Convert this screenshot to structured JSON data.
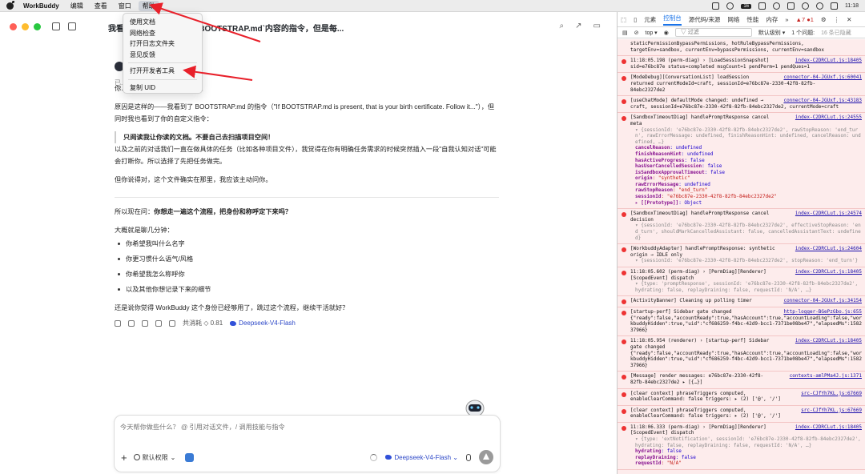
{
  "menubar": {
    "app_name": "WorkBuddy",
    "menus": [
      "编辑",
      "查看",
      "窗口",
      "帮助"
    ],
    "badge": "16",
    "time": "11:18"
  },
  "help_menu": {
    "items": [
      "使用文档",
      "网络检查",
      "打开日志文件夹",
      "意见反馈",
      "打开开发者工具",
      "复制 UID"
    ]
  },
  "chat": {
    "title": "我看到你收到了关于遵循`BOOTSTRAP.md`内容的指令，但是每...",
    "bot_label": "已...",
    "p_partial": "你... BOOTSTRAP.md 的流程。",
    "p1": "原因是这样的——我看到了 BOOTSTRAP.md 的指令（\"If BOOTSTRAP.md is present, that is your birth certificate. Follow it...\"），但同时我也看到了你的自定义指令：",
    "quote": "只阅读我让你读的文档。不要自己去扫描项目空间！",
    "p2": "以及之前的对话我们一直在做具体的任务（比如各种项目文件），我觉得在你有明确任务需求的时候突然插入一段\"自我认知对话\"可能会打断你。所以选择了先把任务做完。",
    "p3": "但你说得对，这个文件确实在那里，我应该主动问你。",
    "ask_prefix": "所以现在问：",
    "ask_bold": "你想走一遍这个流程，把身份和称呼定下来吗？",
    "list_intro": "大概就是聊几分钟：",
    "list": [
      "你希望我叫什么名字",
      "你更习惯什么语气/风格",
      "你希望我怎么称呼你",
      "以及其他你想记录下来的细节"
    ],
    "closing": "还是说你觉得 WorkBuddy 这个身份已经够用了，跳过这个流程，继续干活就好？",
    "cost": "共消耗 ◇ 0.81",
    "model": "Deepseek-V4-Flash"
  },
  "composer": {
    "placeholder": "今天帮你做些什么？ @ 引用对话文件，/ 调用技能与指令",
    "plus": "+",
    "permission": "默认权限",
    "model": "Deepseek-V4-Flash"
  },
  "devtools": {
    "tabs": [
      "元素",
      "控制台",
      "源代码/来源",
      "网络",
      "性能",
      "内存"
    ],
    "active_tab": "控制台",
    "warn_count": "7",
    "err_count": "1",
    "context": "top",
    "filter_placeholder": "过滤",
    "level": "默认级别",
    "issues": "1 个问题:",
    "hidden": "16 条已隐藏"
  },
  "console": [
    {
      "src": "",
      "lines": [
        "staticPermissionBypassPermissions, hotRuleBypassPermissions,",
        "targetEnv=sandbox, currentEnv=bypassPermissions, currentEnv=sandbox"
      ]
    },
    {
      "src": "index-C2DRCLut.js:18405",
      "lines": [
        "11:18:05.198 (perm-diag) › [LoadSessionSnapshot]",
        "sid=e76bc87e status=completed msgCount=1 pendPerm=1 pendQues=1"
      ]
    },
    {
      "src": "connector-04-JGUxf.js:60041",
      "lines": [
        "[ModeDebug][ConversationList] loadSession",
        "returned currentModeId=craft, sessionId=e76bc87e-2330-42f8-82fb-",
        "84ebc2327de2"
      ]
    },
    {
      "src": "connector-04-JGUxf.js:43183",
      "lines": [
        "[useChatMode] defaultMode changed: undefined →",
        "craft, sessionId=e76bc87e-2330-42f8-82fb-84ebc2327de2, currentMode=craft"
      ]
    },
    {
      "src": "index-C2DRCLut.js:24555",
      "lines": [
        "[SandboxTimeoutDiag] handlePromptResponse cancel",
        "meta"
      ],
      "props": [
        "{sessionId: 'e76bc87e-2330-42f8-82fb-84ebc2327de2', rawStopReason: 'end_turn', rawErrorMessage: undefined, finishReasonHint: undefined, cancelReason: undefined, …}",
        "cancelReason: undefined",
        "finishReasonHint: undefined",
        "hasActiveProgress: false",
        "hasUserCancelledSession: false",
        "isSandboxApprovalTimeout: false",
        "origin: \"synthetic\"",
        "rawErrorMessage: undefined",
        "rawStopReason: \"end_turn\"",
        "sessionId: \"e76bc87e-2330-42f8-82fb-84ebc2327de2\"",
        "▸ [[Prototype]]: Object"
      ]
    },
    {
      "src": "index-C2DRCLut.js:24574",
      "lines": [
        "[SandboxTimeoutDiag] handlePromptResponse cancel",
        "decision"
      ],
      "props": [
        "{sessionId: 'e76bc87e-2330-42f8-82fb-84ebc2327de2', effectiveStopReason: 'end_turn', shouldMarkCancelledAssistant: false, cancelledAssistantText: undefined}"
      ]
    },
    {
      "src": "index-C2DRCLut.js:24604",
      "lines": [
        "[WorkbuddyAdapter] handlePromptResponse: synthetic",
        "origin → IDLE only"
      ],
      "props": [
        "{sessionId: 'e76bc87e-2330-42f8-82fb-84ebc2327de2', stopReason: 'end_turn'}"
      ]
    },
    {
      "src": "index-C2DRCLut.js:18405",
      "lines": [
        "11:18:05.602 (perm-diag) › [PermDiag][Renderer]",
        "[ScopedEvent] dispatch"
      ],
      "props": [
        "{type: 'promptResponse', sessionId: 'e76bc87e-2330-42f8-82fb-84ebc2327de2', hydrating: false, replayDraining: false, requestId: 'N/A', …}"
      ]
    },
    {
      "src": "connector-04-JGUxf.js:34154",
      "lines": [
        "[ActivityBanner] Cleaning up polling timer"
      ]
    },
    {
      "src": "http-logger-BGePzGbo.js:655",
      "lines": [
        "[startup-perf] Sidebar gate changed",
        "{\"ready\":false,\"accountReady\":true,\"hasAccount\":true,\"accountLoading\":false,\"workbuddyHidden\":true,\"uid\":\"cf686259-f4bc-42d9-bcc1-7371be08be47\",\"elapsedMs\":158237966}"
      ]
    },
    {
      "src": "index-C2DRCLut.js:18405",
      "lines": [
        "11:18:05.954 (renderer) › [startup-perf] Sidebar",
        "gate changed",
        "{\"ready\":false,\"accountReady\":true,\"hasAccount\":true,\"accountLoading\":false,\"workbuddyHidden\":true,\"uid\":\"cf686259-f4bc-42d9-bcc1-7371be08be47\",\"elapsedMs\":158237966}"
      ]
    },
    {
      "src": "contexts-amlPMa4J.js:1371",
      "lines": [
        "[Message] render messages: e76bc87e-2330-42f8-",
        "82fb-84ebc2327de2 ▸ [{…}]"
      ]
    },
    {
      "src": "src-CJfYh7KL.js:67669",
      "lines": [
        "[clear context] phraseTriggers computed,",
        "enableClearCommand: false triggers: ▸ (2) ['@', '/']"
      ]
    },
    {
      "src": "src-CJfYh7KL.js:67669",
      "lines": [
        "[clear context] phraseTriggers computed,",
        "enableClearCommand: false triggers: ▸ (2) ['@', '/']"
      ]
    },
    {
      "src": "index-C2DRCLut.js:18405",
      "lines": [
        "11:18:06.333 (perm-diag) › [PermDiag][Renderer]",
        "[ScopedEvent] dispatch"
      ],
      "props": [
        "{type: 'extNotification', sessionId: 'e76bc87e-2330-42f8-82fb-84ebc2327de2', hydrating: false, replayDraining: false, requestId: 'N/A', …}",
        "hydrating: false",
        "replayDraining: false",
        "requestId: \"N/A\""
      ]
    }
  ]
}
